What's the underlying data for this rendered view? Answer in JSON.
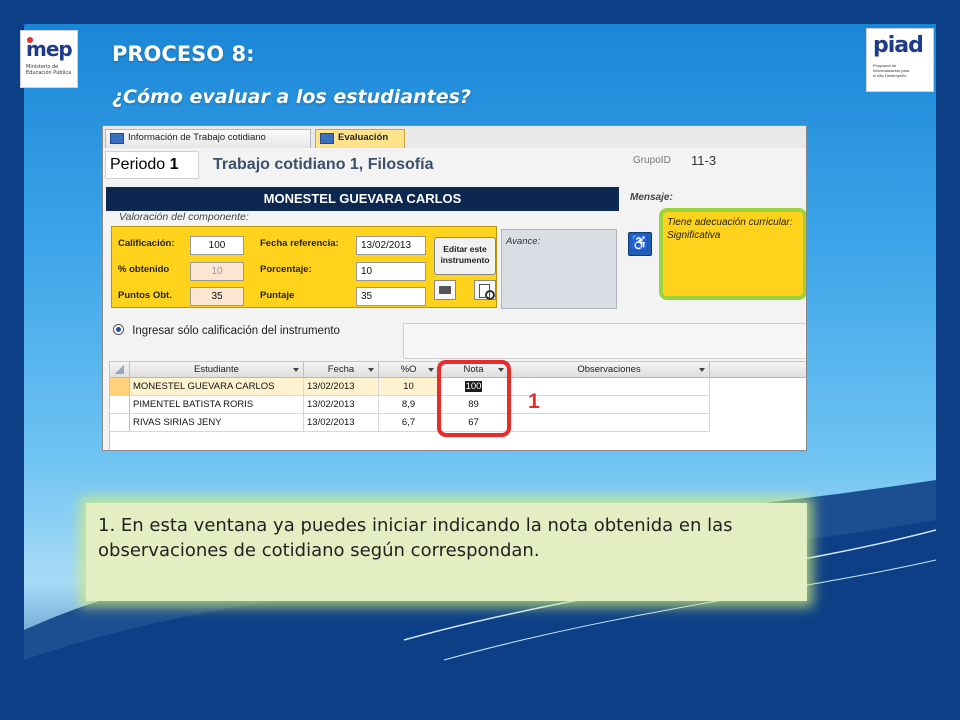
{
  "slide": {
    "heading": "PROCESO 8:",
    "subheading": "¿Cómo evaluar a los estudiantes?",
    "callout_number": "1",
    "note_text": "1. En esta ventana ya puedes iniciar indicando la nota obtenida en las observaciones de cotidiano según correspondan."
  },
  "logos": {
    "left": {
      "word": "mep",
      "sub": "Ministerio de Educación Pública"
    },
    "right": {
      "word": "piad",
      "sub": "Programa de Informatización para el Alto Desempeño"
    }
  },
  "app": {
    "tabs": [
      {
        "label": "Información de Trabajo cotidiano",
        "active": false
      },
      {
        "label": "Evaluación",
        "active": true
      }
    ],
    "periodo_label": "Periodo",
    "periodo_value": "1",
    "title": "Trabajo cotidiano 1, Filosofía",
    "grupo_label": "GrupoID",
    "grupo_value": "11-3",
    "student_name": "MONESTEL GUEVARA CARLOS",
    "mensaje_label": "Mensaje:",
    "valoracion_label": "Valoración del componente:",
    "fields": {
      "calificacion": {
        "label": "Calificación:",
        "value": "100"
      },
      "porcentaje_obtenido": {
        "label": "% obtenido",
        "value": "10"
      },
      "puntos_obtenidos": {
        "label": "Puntos Obt.",
        "value": "35"
      },
      "fecha_referencia": {
        "label": "Fecha referencia:",
        "value": "13/02/2013"
      },
      "porcentaje": {
        "label": "Porcentaje:",
        "value": "10"
      },
      "puntaje": {
        "label": "Puntaje",
        "value": "35"
      }
    },
    "edit_button_label": "Editar este instrumento",
    "avance_label": "Avance:",
    "mensaje_text": "Tiene adecuación curricular: Significativa",
    "radio_label": "Ingresar sólo calificación del instrumento",
    "grid": {
      "columns": [
        "Estudiante",
        "Fecha",
        "%O",
        "Nota",
        "Observaciones"
      ],
      "rows": [
        {
          "estudiante": "MONESTEL GUEVARA CARLOS",
          "fecha": "13/02/2013",
          "porcentaje": "10",
          "nota": "100",
          "observaciones": ""
        },
        {
          "estudiante": "PIMENTEL BATISTA RORIS",
          "fecha": "13/02/2013",
          "porcentaje": "8,9",
          "nota": "89",
          "observaciones": ""
        },
        {
          "estudiante": "RIVAS SIRIAS JENY",
          "fecha": "13/02/2013",
          "porcentaje": "6,7",
          "nota": "67",
          "observaciones": ""
        }
      ]
    }
  },
  "colors": {
    "slide_blue": "#0c3f86",
    "form_yellow": "#ffd21c",
    "highlight_red": "#e82c2c",
    "note_green": "#e3efc2"
  }
}
